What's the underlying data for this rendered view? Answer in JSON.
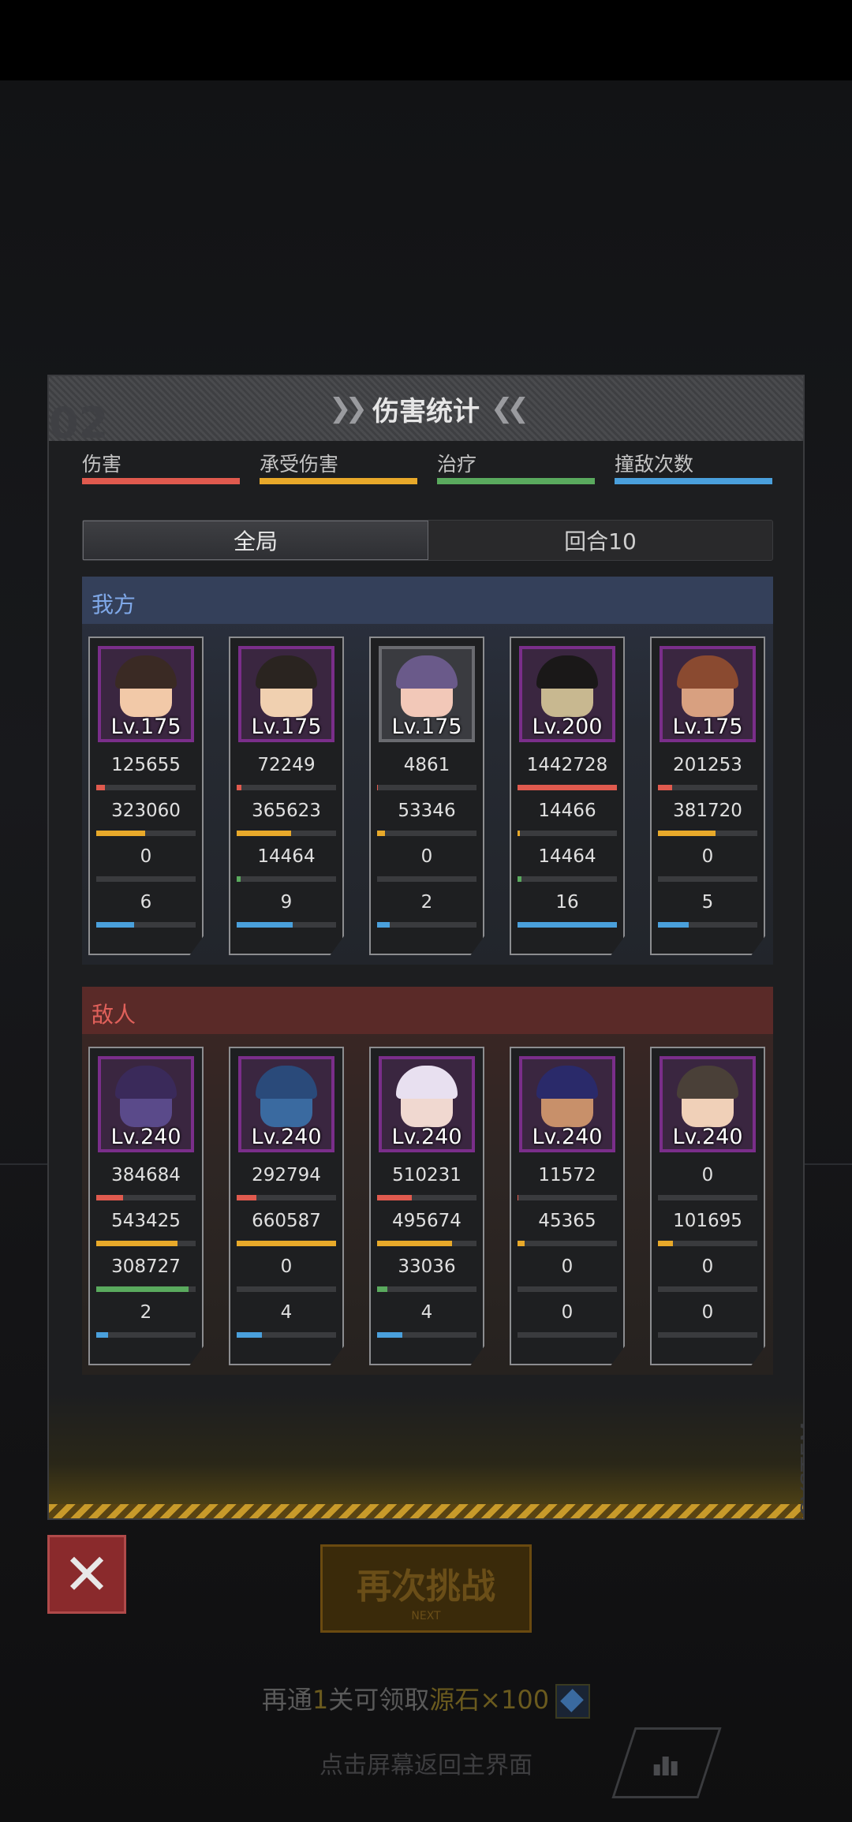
{
  "panel": {
    "title": "伤害统计",
    "corner_number": "02",
    "legend": [
      {
        "label": "伤害",
        "color": "#e05a4e"
      },
      {
        "label": "承受伤害",
        "color": "#e8a92a"
      },
      {
        "label": "治疗",
        "color": "#5aaa5e"
      },
      {
        "label": "撞敌次数",
        "color": "#4aa0dc"
      }
    ],
    "tabs": [
      {
        "label": "全局",
        "active": true
      },
      {
        "label": "回合10",
        "active": false
      }
    ],
    "system_text": "SYSTEM"
  },
  "allies": {
    "title": "我方",
    "units": [
      {
        "level": "Lv.175",
        "damage": "125655",
        "damage_taken": "323060",
        "healing": "0",
        "hits": "6",
        "ratios": [
          0.09,
          0.49,
          0.0,
          0.38
        ],
        "palette": {
          "hair": "#3a2a24",
          "skin": "#f2c9a8"
        }
      },
      {
        "level": "Lv.175",
        "damage": "72249",
        "damage_taken": "365623",
        "healing": "14464",
        "hits": "9",
        "ratios": [
          0.05,
          0.55,
          0.04,
          0.56
        ],
        "palette": {
          "hair": "#2a2420",
          "skin": "#f0d0b0"
        }
      },
      {
        "level": "Lv.175",
        "damage": "4861",
        "damage_taken": "53346",
        "healing": "0",
        "hits": "2",
        "ratios": [
          0.005,
          0.08,
          0.0,
          0.13
        ],
        "palette": {
          "hair": "#6a5a8a",
          "skin": "#f2c8b8"
        }
      },
      {
        "level": "Lv.200",
        "damage": "1442728",
        "damage_taken": "14466",
        "healing": "14464",
        "hits": "16",
        "ratios": [
          1.0,
          0.02,
          0.04,
          1.0
        ],
        "palette": {
          "hair": "#1a1818",
          "skin": "#c8b890"
        }
      },
      {
        "level": "Lv.175",
        "damage": "201253",
        "damage_taken": "381720",
        "healing": "0",
        "hits": "5",
        "ratios": [
          0.14,
          0.58,
          0.0,
          0.31
        ],
        "palette": {
          "hair": "#8a4a30",
          "skin": "#d8a080"
        }
      }
    ]
  },
  "enemies": {
    "title": "敌人",
    "units": [
      {
        "level": "Lv.240",
        "damage": "384684",
        "damage_taken": "543425",
        "healing": "308727",
        "hits": "2",
        "ratios": [
          0.27,
          0.82,
          0.93,
          0.12
        ],
        "palette": {
          "hair": "#3a2a5a",
          "skin": "#5a4a8a"
        }
      },
      {
        "level": "Lv.240",
        "damage": "292794",
        "damage_taken": "660587",
        "healing": "0",
        "hits": "4",
        "ratios": [
          0.2,
          1.0,
          0.0,
          0.25
        ],
        "palette": {
          "hair": "#2a4a7a",
          "skin": "#3a6aa0"
        }
      },
      {
        "level": "Lv.240",
        "damage": "510231",
        "damage_taken": "495674",
        "healing": "33036",
        "hits": "4",
        "ratios": [
          0.35,
          0.75,
          0.1,
          0.25
        ],
        "palette": {
          "hair": "#e8e0f0",
          "skin": "#f0d8d0"
        }
      },
      {
        "level": "Lv.240",
        "damage": "11572",
        "damage_taken": "45365",
        "healing": "0",
        "hits": "0",
        "ratios": [
          0.01,
          0.07,
          0.0,
          0.0
        ],
        "palette": {
          "hair": "#2a2a6a",
          "skin": "#c8906a"
        }
      },
      {
        "level": "Lv.240",
        "damage": "0",
        "damage_taken": "101695",
        "healing": "0",
        "hits": "0",
        "ratios": [
          0.0,
          0.15,
          0.0,
          0.0
        ],
        "palette": {
          "hair": "#4a4038",
          "skin": "#f0d0b8"
        }
      }
    ]
  },
  "actions": {
    "retry_label": "再次挑战",
    "retry_sub": "NEXT",
    "reward_prefix": "再通",
    "reward_count": "1",
    "reward_middle": "关可领取",
    "reward_item": "源石×100",
    "hint": "点击屏幕返回主界面"
  }
}
